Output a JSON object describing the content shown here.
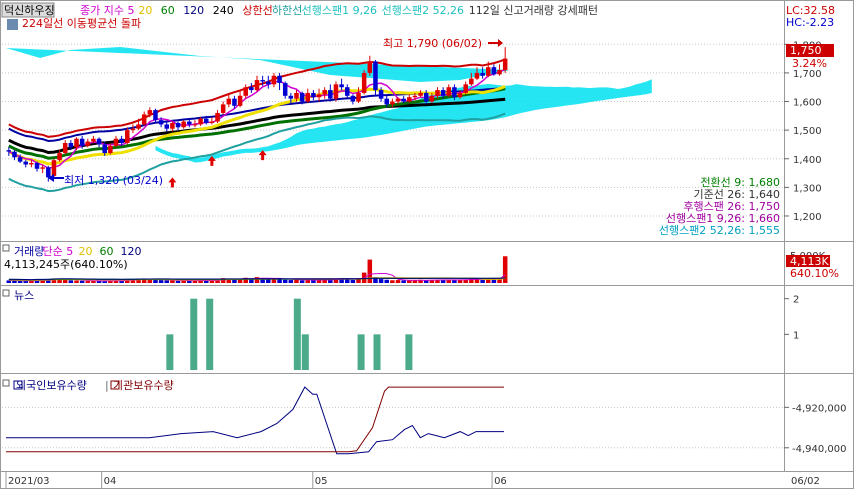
{
  "chart_data": [
    {
      "panel": "price",
      "type": "candlestick",
      "title": "덕신하우징",
      "indicator_labels": [
        "종가 지수 5",
        "20",
        "60",
        "120",
        "240",
        "상한선",
        "하한선",
        "선행스팬1 9,26",
        "선행스팬2 52,26",
        "112일 신고거래량 강세패턴"
      ],
      "indicator_colors": [
        "#d000d0",
        "#e0c000",
        "#008000",
        "#000080",
        "#000000",
        "#cc0000",
        "#20a0a0",
        "#20c0c0",
        "#20c0c0",
        "#333333"
      ],
      "subtitle": "224일선 이동평균선 돌파",
      "lc_label": "LC:32.58",
      "hc_label": "HC:-2.23",
      "max_annotation": "최고 1,790 (06/02)",
      "min_annotation": "최저 1,320 (03/24)",
      "current_price": "1,750",
      "change_pct": "3.24%",
      "ylim": [
        1130,
        1850
      ],
      "yticks": [
        "1,800",
        "1,700",
        "1,600",
        "1,500",
        "1,400",
        "1,300",
        "1,200"
      ],
      "ytick_values": [
        1800,
        1700,
        1600,
        1500,
        1400,
        1300,
        1200
      ],
      "legend_values": [
        "전환선 9: 1,680",
        "기준선 26: 1,640",
        "후행스팬 26: 1,750",
        "선행스팬1 9,26: 1,660",
        "선행스팬2 52,26: 1,555"
      ],
      "legend_colors": [
        "#008000",
        "#333333",
        "#a000a0",
        "#a000a0",
        "#00a0c0"
      ],
      "candles": [
        [
          1430,
          1425,
          1440,
          1410
        ],
        [
          1425,
          1405,
          1430,
          1395
        ],
        [
          1405,
          1390,
          1415,
          1385
        ],
        [
          1390,
          1380,
          1395,
          1370
        ],
        [
          1380,
          1385,
          1395,
          1370
        ],
        [
          1385,
          1365,
          1390,
          1355
        ],
        [
          1365,
          1370,
          1380,
          1350
        ],
        [
          1370,
          1335,
          1375,
          1320
        ],
        [
          1340,
          1395,
          1400,
          1335
        ],
        [
          1395,
          1420,
          1430,
          1390
        ],
        [
          1420,
          1455,
          1465,
          1415
        ],
        [
          1455,
          1440,
          1465,
          1430
        ],
        [
          1440,
          1470,
          1475,
          1430
        ],
        [
          1470,
          1445,
          1480,
          1435
        ],
        [
          1445,
          1460,
          1470,
          1440
        ],
        [
          1460,
          1470,
          1480,
          1455
        ],
        [
          1470,
          1450,
          1475,
          1440
        ],
        [
          1450,
          1420,
          1460,
          1410
        ],
        [
          1420,
          1445,
          1455,
          1415
        ],
        [
          1445,
          1470,
          1480,
          1440
        ],
        [
          1470,
          1455,
          1480,
          1445
        ],
        [
          1455,
          1500,
          1510,
          1450
        ],
        [
          1500,
          1505,
          1520,
          1490
        ],
        [
          1505,
          1520,
          1540,
          1500
        ],
        [
          1520,
          1555,
          1565,
          1515
        ],
        [
          1555,
          1570,
          1580,
          1545
        ],
        [
          1570,
          1535,
          1575,
          1525
        ],
        [
          1535,
          1520,
          1545,
          1510
        ],
        [
          1520,
          1505,
          1530,
          1495
        ],
        [
          1505,
          1525,
          1530,
          1495
        ],
        [
          1525,
          1510,
          1530,
          1500
        ],
        [
          1510,
          1530,
          1535,
          1505
        ],
        [
          1530,
          1520,
          1540,
          1510
        ],
        [
          1520,
          1520,
          1535,
          1510
        ],
        [
          1520,
          1540,
          1545,
          1515
        ],
        [
          1540,
          1525,
          1550,
          1520
        ],
        [
          1525,
          1530,
          1545,
          1520
        ],
        [
          1530,
          1560,
          1570,
          1525
        ],
        [
          1560,
          1590,
          1600,
          1555
        ],
        [
          1590,
          1610,
          1625,
          1580
        ],
        [
          1610,
          1585,
          1620,
          1575
        ],
        [
          1585,
          1620,
          1640,
          1580
        ],
        [
          1620,
          1650,
          1660,
          1610
        ],
        [
          1650,
          1640,
          1665,
          1630
        ],
        [
          1640,
          1675,
          1690,
          1635
        ],
        [
          1675,
          1670,
          1690,
          1655
        ],
        [
          1670,
          1660,
          1690,
          1645
        ],
        [
          1660,
          1690,
          1700,
          1650
        ],
        [
          1690,
          1665,
          1700,
          1640
        ],
        [
          1665,
          1620,
          1670,
          1610
        ],
        [
          1620,
          1610,
          1630,
          1590
        ],
        [
          1610,
          1630,
          1640,
          1600
        ],
        [
          1630,
          1600,
          1635,
          1590
        ],
        [
          1600,
          1630,
          1645,
          1595
        ],
        [
          1630,
          1615,
          1640,
          1605
        ],
        [
          1615,
          1625,
          1645,
          1600
        ],
        [
          1625,
          1640,
          1650,
          1610
        ],
        [
          1640,
          1610,
          1660,
          1600
        ],
        [
          1610,
          1660,
          1670,
          1600
        ],
        [
          1660,
          1650,
          1680,
          1640
        ],
        [
          1650,
          1620,
          1660,
          1610
        ],
        [
          1620,
          1600,
          1625,
          1590
        ],
        [
          1600,
          1630,
          1650,
          1595
        ],
        [
          1630,
          1700,
          1710,
          1625
        ],
        [
          1700,
          1740,
          1760,
          1690
        ],
        [
          1740,
          1640,
          1745,
          1620
        ],
        [
          1640,
          1610,
          1650,
          1600
        ],
        [
          1610,
          1590,
          1620,
          1580
        ],
        [
          1590,
          1600,
          1610,
          1580
        ],
        [
          1600,
          1610,
          1615,
          1590
        ],
        [
          1610,
          1600,
          1620,
          1595
        ],
        [
          1600,
          1615,
          1625,
          1595
        ],
        [
          1615,
          1620,
          1630,
          1605
        ],
        [
          1620,
          1630,
          1640,
          1615
        ],
        [
          1630,
          1600,
          1640,
          1590
        ],
        [
          1600,
          1620,
          1630,
          1595
        ],
        [
          1620,
          1640,
          1650,
          1610
        ],
        [
          1640,
          1620,
          1650,
          1610
        ],
        [
          1620,
          1650,
          1660,
          1615
        ],
        [
          1650,
          1615,
          1660,
          1605
        ],
        [
          1615,
          1630,
          1640,
          1610
        ],
        [
          1630,
          1660,
          1670,
          1625
        ],
        [
          1660,
          1680,
          1700,
          1655
        ],
        [
          1680,
          1700,
          1720,
          1675
        ],
        [
          1700,
          1690,
          1720,
          1680
        ],
        [
          1690,
          1720,
          1740,
          1685
        ],
        [
          1720,
          1695,
          1730,
          1690
        ],
        [
          1695,
          1710,
          1730,
          1690
        ],
        [
          1710,
          1750,
          1790,
          1700
        ]
      ]
    },
    {
      "panel": "volume",
      "type": "bar",
      "labels": [
        "거래량",
        "단순 5",
        "20",
        "60",
        "120"
      ],
      "label_colors": [
        "#0000a0",
        "#d000d0",
        "#e0c000",
        "#008000",
        "#000080"
      ],
      "value_text": "4,113,245주(640.10%)",
      "axis_top_label": "5,000K",
      "current_volume": "4,113K",
      "volume_pct": "640.10%",
      "ylim": [
        0,
        6000
      ],
      "values": [
        400,
        380,
        350,
        300,
        320,
        500,
        420,
        600,
        700,
        650,
        500,
        420,
        380,
        350,
        300,
        320,
        350,
        280,
        330,
        400,
        380,
        600,
        420,
        650,
        700,
        500,
        480,
        450,
        420,
        400,
        350,
        380,
        400,
        350,
        420,
        380,
        350,
        500,
        750,
        700,
        500,
        650,
        800,
        600,
        900,
        650,
        700,
        650,
        600,
        500,
        450,
        480,
        420,
        500,
        450,
        480,
        500,
        450,
        700,
        650,
        550,
        480,
        600,
        1600,
        3600,
        900,
        600,
        500,
        420,
        450,
        400,
        380,
        420,
        500,
        450,
        480,
        420,
        500,
        520,
        450,
        480,
        500,
        650,
        700,
        500,
        650,
        550,
        600,
        4113
      ]
    },
    {
      "panel": "news",
      "type": "bar",
      "label": "뉴스",
      "yticks": [
        "2",
        "1"
      ],
      "ylim": [
        0,
        2.3
      ],
      "bars": [
        [
          41,
          1
        ],
        [
          47,
          2
        ],
        [
          51,
          2
        ],
        [
          73,
          2
        ],
        [
          75,
          1
        ],
        [
          89,
          1
        ],
        [
          93,
          1
        ],
        [
          101,
          1
        ]
      ]
    },
    {
      "panel": "holdings",
      "type": "line",
      "labels": [
        "외국인보유수량",
        "기관보유수량"
      ],
      "label_colors": [
        "#000080",
        "#800000"
      ],
      "yticks": [
        "-4,920,000",
        "-4,940,000"
      ],
      "ytick_values": [
        -4920000,
        -4940000
      ],
      "ylim": [
        -4950000,
        -4905000
      ],
      "foreign": [
        [
          0,
          -4935000
        ],
        [
          36,
          -4935000
        ],
        [
          44,
          -4933000
        ],
        [
          52,
          -4932000
        ],
        [
          58,
          -4935000
        ],
        [
          64,
          -4932000
        ],
        [
          68,
          -4928000
        ],
        [
          72,
          -4921000
        ],
        [
          75,
          -4910000
        ],
        [
          77,
          -4913500
        ],
        [
          78,
          -4913500
        ],
        [
          83,
          -4943000
        ],
        [
          86,
          -4943000
        ],
        [
          91,
          -4942000
        ],
        [
          93,
          -4937000
        ],
        [
          97,
          -4936000
        ],
        [
          100,
          -4931000
        ],
        [
          102,
          -4929000
        ],
        [
          104,
          -4935000
        ],
        [
          106,
          -4933000
        ],
        [
          108,
          -4934000
        ],
        [
          110,
          -4935000
        ],
        [
          114,
          -4932000
        ],
        [
          116,
          -4934000
        ],
        [
          118,
          -4932000
        ],
        [
          122,
          -4932000
        ],
        [
          125,
          -4932000
        ]
      ],
      "institution": [
        [
          0,
          -4942000
        ],
        [
          20,
          -4942000
        ],
        [
          80,
          -4942000
        ],
        [
          86,
          -4942000
        ],
        [
          88,
          -4941500
        ],
        [
          92,
          -4930000
        ],
        [
          95,
          -4912000
        ],
        [
          96,
          -4910000
        ],
        [
          125,
          -4910000
        ]
      ]
    },
    {
      "panel": "date_axis",
      "type": "axis",
      "labels": [
        "2021/03",
        "04",
        "05",
        "06"
      ],
      "label_index": [
        0,
        24,
        77,
        122
      ],
      "end_label": "06/02"
    }
  ]
}
